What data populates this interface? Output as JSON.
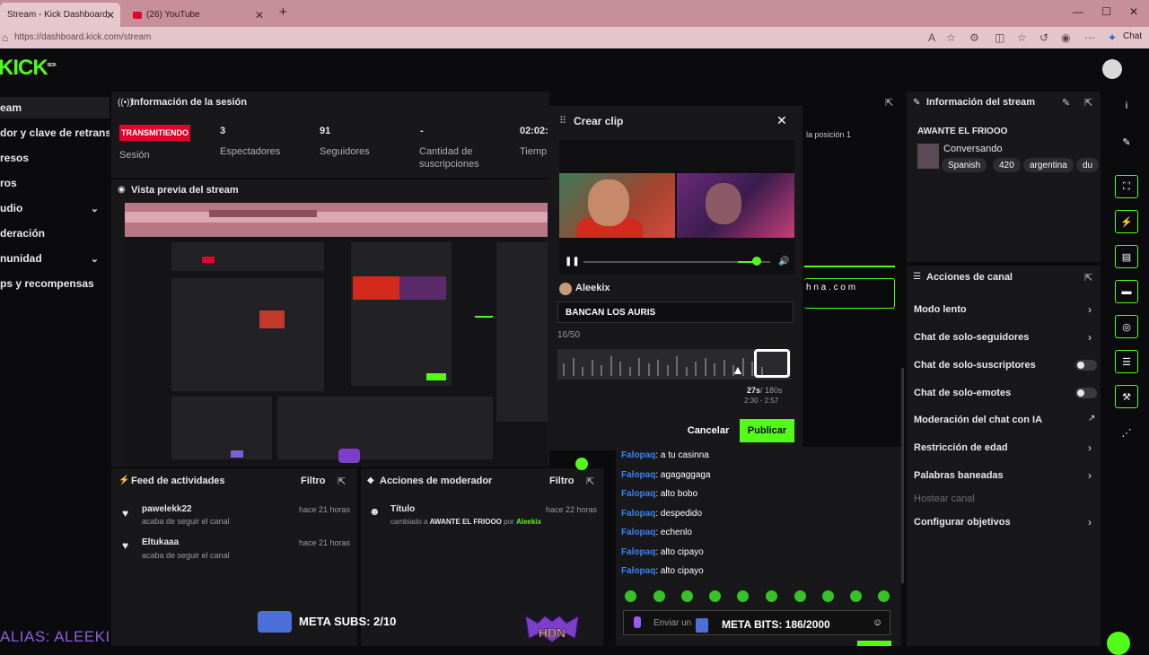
{
  "browser": {
    "tabs": [
      {
        "label": "Stream - Kick Dashboard"
      },
      {
        "label": "(26) YouTube"
      }
    ],
    "url": "https://dashboard.kick.com/stream",
    "chat_button": "Chat"
  },
  "app": {
    "logo": "KICK",
    "logo_badge": "BETA"
  },
  "sidebar": {
    "items": [
      {
        "label": "eam"
      },
      {
        "label": "dor y clave de retransm"
      },
      {
        "label": "resos"
      },
      {
        "label": "ros"
      },
      {
        "label": "udio"
      },
      {
        "label": "deración"
      },
      {
        "label": "nunidad"
      },
      {
        "label": "ps y recompensas"
      }
    ]
  },
  "session": {
    "title": "Información de la sesión",
    "status": "TRANSMITIENDO",
    "status_label": "Sesión",
    "viewers": "3",
    "viewers_label": "Espectadores",
    "followers": "91",
    "followers_label": "Seguidores",
    "subs": "-",
    "subs_label": "Cantidad de suscripciones",
    "time": "02:02:",
    "time_label": "Tiemp"
  },
  "preview": {
    "title": "Vista previa del stream"
  },
  "clip": {
    "title": "Crear clip",
    "author": "Aleekix",
    "input_value": "BANCAN LOS AURIS",
    "char_count": "16/50",
    "duration": "27s",
    "duration_max": "/ 180s",
    "range": "2:30 - 2:57",
    "cancel": "Cancelar",
    "publish": "Publicar",
    "playback_position": 0.93
  },
  "background_text": {
    "position": "la posición 1",
    "link": "h n a . c o m"
  },
  "activity": {
    "title": "Feed de actividades",
    "filter": "Filtro",
    "items": [
      {
        "user": "pawelekk22",
        "action": "acaba de seguir el canal",
        "time": "hace 21 horas"
      },
      {
        "user": "Eltukaaa",
        "action": "acaba de seguir el canal",
        "time": "hace 21 horas"
      }
    ]
  },
  "moderator": {
    "title": "Acciones de moderador",
    "filter": "Filtro",
    "item_title": "Título",
    "item_prefix": "cambiado a",
    "item_value": "AWANTE EL FRIOOO",
    "item_by": "por",
    "item_user": "Aleekix",
    "item_time": "hace 22 horas"
  },
  "chat": {
    "lines": [
      {
        "user": "Falopaq",
        "msg": ": a tu casinna"
      },
      {
        "user": "Falopaq",
        "msg": ": agagaggaga"
      },
      {
        "user": "Falopaq",
        "msg": ": alto bobo"
      },
      {
        "user": "Falopaq",
        "msg": ": despedido"
      },
      {
        "user": "Falopaq",
        "msg": ": echenlo"
      },
      {
        "user": "Falopaq",
        "msg": ": alto cipayo"
      },
      {
        "user": "Falopaq",
        "msg": ": alto cipayo"
      }
    ],
    "placeholder": "Enviar un"
  },
  "stream_info": {
    "title": "Información del stream",
    "stream_title": "AWANTE EL FRIOOO",
    "category": "Conversando",
    "tags": [
      "Spanish",
      "420",
      "argentina",
      "du"
    ]
  },
  "channel_actions": {
    "title": "Acciones de canal",
    "items": [
      {
        "label": "Modo lento",
        "control": "chevron"
      },
      {
        "label": "Chat de solo-seguidores",
        "control": "chevron"
      },
      {
        "label": "Chat de solo-suscriptores",
        "control": "toggle"
      },
      {
        "label": "Chat de solo-emotes",
        "control": "toggle"
      },
      {
        "label": "Moderación del chat con IA",
        "control": "external"
      },
      {
        "label": "Restricción de edad",
        "control": "chevron"
      },
      {
        "label": "Palabras baneadas",
        "control": "chevron"
      },
      {
        "label": "Hostear canal",
        "control": "none"
      },
      {
        "label": "Configurar objetivos",
        "control": "chevron"
      }
    ]
  },
  "overlay": {
    "alias": "ALIAS: ALEEKI",
    "meta_subs": "META SUBS: 2/10",
    "meta_bits": "META BITS: 186/2000",
    "hdn": "HDN"
  },
  "colors": {
    "accent": "#53fc18",
    "live": "#e4002b",
    "chat_user": "#3b82f6"
  }
}
